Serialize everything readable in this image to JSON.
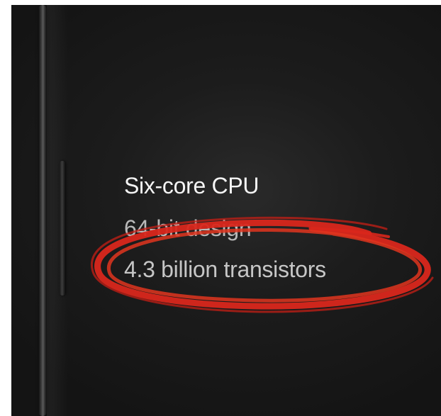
{
  "slide": {
    "specs": [
      "Six-core CPU",
      "64-bit design",
      "4.3 billion transistors"
    ]
  },
  "annotation": {
    "shape": "hand-drawn-ellipse",
    "color": "#d9271c",
    "highlighted_item": "4.3 billion transistors"
  },
  "colors": {
    "background": "#1c1c1c",
    "primary_text": "#f4f4f4",
    "secondary_text": "#b9b9b9",
    "marker": "#d9271c"
  }
}
